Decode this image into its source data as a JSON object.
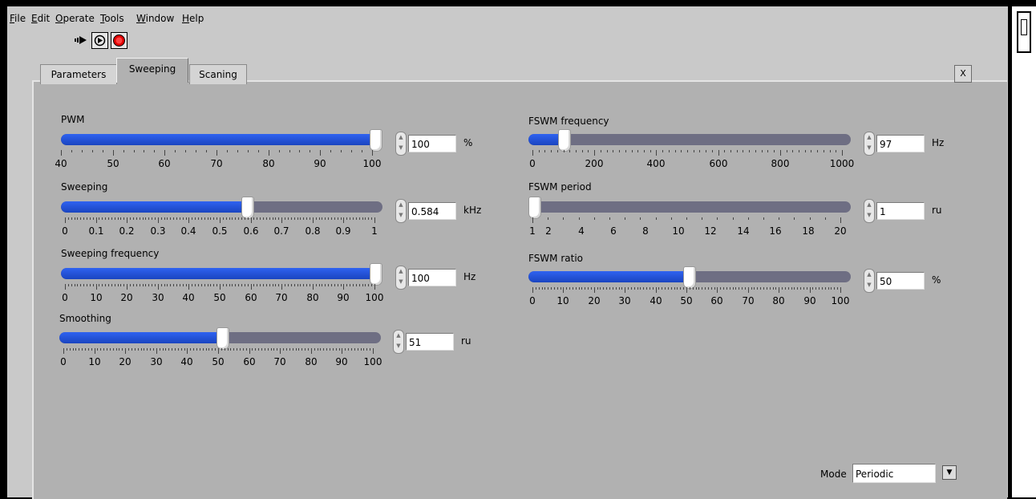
{
  "menu": {
    "items": [
      {
        "pre": "",
        "u": "F",
        "post": "ile"
      },
      {
        "pre": "",
        "u": "E",
        "post": "dit"
      },
      {
        "pre": "",
        "u": "O",
        "post": "perate"
      },
      {
        "pre": "",
        "u": "T",
        "post": "ools"
      },
      {
        "pre": "",
        "u": "W",
        "post": "indow"
      },
      {
        "pre": "",
        "u": "H",
        "post": "elp"
      }
    ]
  },
  "toolbar": {
    "run_icon": "run-arrow-icon",
    "continuous_icon": "run-continuously-icon",
    "abort_icon": "abort-stop-icon"
  },
  "tabs": [
    "Parameters",
    "Sweeping",
    "Scaning"
  ],
  "active_tab": "Sweeping",
  "close_label": "X",
  "controls": {
    "pwm": {
      "label": "PWM",
      "value": "100",
      "unit": "%",
      "fraction": 1.0,
      "ticks": [
        "40",
        "50",
        "60",
        "70",
        "80",
        "90",
        "100"
      ]
    },
    "sweeping": {
      "label": "Sweeping",
      "value": "0.584",
      "unit": "kHz",
      "fraction": 0.584,
      "ticks": [
        "0",
        "0.1",
        "0.2",
        "0.3",
        "0.4",
        "0.5",
        "0.6",
        "0.7",
        "0.8",
        "0.9",
        "1"
      ]
    },
    "sweeping_frequency": {
      "label": "Sweeping frequency",
      "value": "100",
      "unit": "Hz",
      "fraction": 1.0,
      "ticks": [
        "0",
        "10",
        "20",
        "30",
        "40",
        "50",
        "60",
        "70",
        "80",
        "90",
        "100"
      ]
    },
    "smoothing": {
      "label": "Smoothing",
      "value": "51",
      "unit": "ru",
      "fraction": 0.51,
      "ticks": [
        "0",
        "10",
        "20",
        "30",
        "40",
        "50",
        "60",
        "70",
        "80",
        "90",
        "100"
      ]
    },
    "fswm_frequency": {
      "label": "FSWM frequency",
      "value": "97",
      "unit": "Hz",
      "fraction": 0.097,
      "ticks": [
        "0",
        "200",
        "400",
        "600",
        "800",
        "1000"
      ]
    },
    "fswm_period": {
      "label": "FSWM period",
      "value": "1",
      "unit": "ru",
      "fraction": 0.0,
      "ticks": [
        "1",
        "2",
        "4",
        "6",
        "8",
        "10",
        "12",
        "14",
        "16",
        "18",
        "20"
      ]
    },
    "fswm_ratio": {
      "label": "FSWM ratio",
      "value": "50",
      "unit": "%",
      "fraction": 0.5,
      "ticks": [
        "0",
        "10",
        "20",
        "30",
        "40",
        "50",
        "60",
        "70",
        "80",
        "90",
        "100"
      ]
    }
  },
  "mode": {
    "label": "Mode",
    "value": "Periodic"
  }
}
